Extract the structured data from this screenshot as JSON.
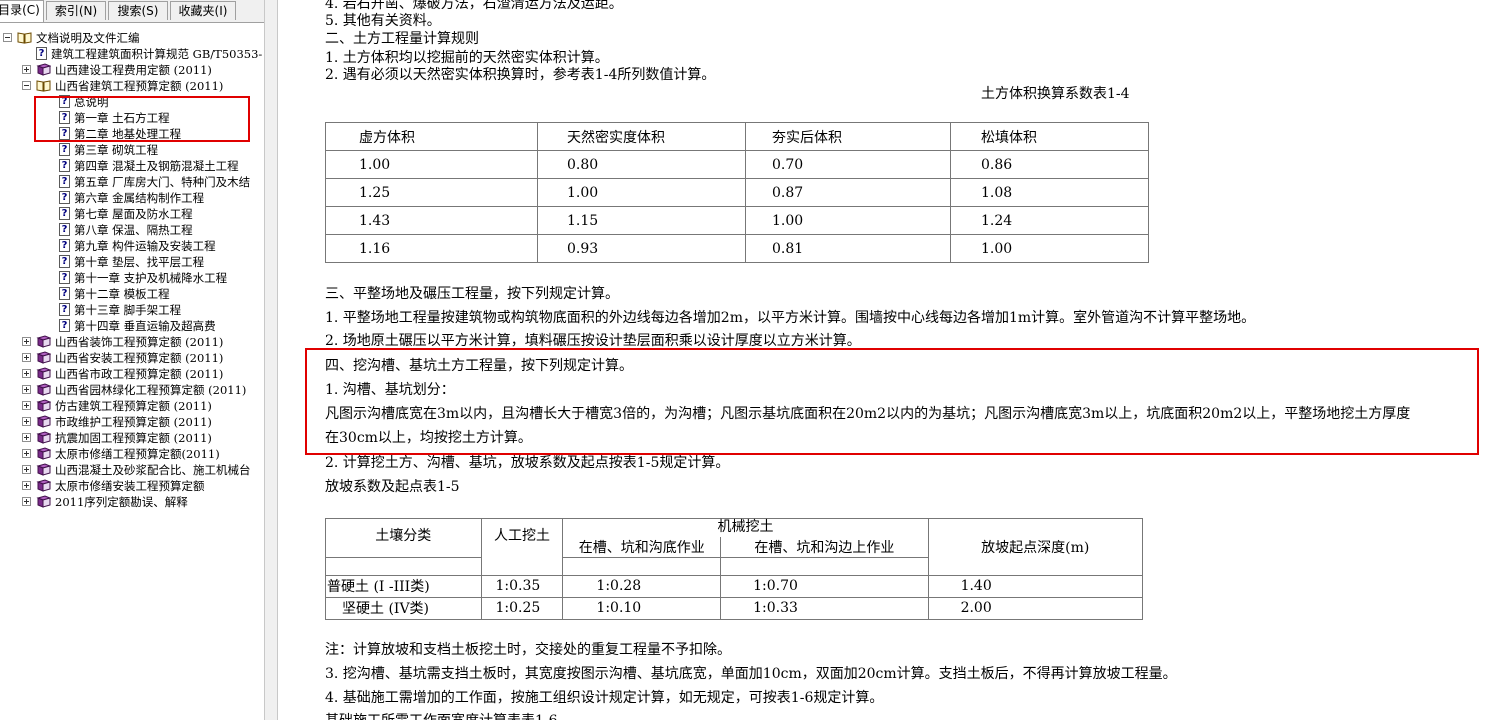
{
  "tabs": [
    {
      "label": "目录(C)",
      "active": true
    },
    {
      "label": "索引(N)",
      "active": false
    },
    {
      "label": "搜索(S)",
      "active": false
    },
    {
      "label": "收藏夹(I)",
      "active": false
    }
  ],
  "tree": [
    {
      "label": "文档说明及文件汇编",
      "level": 0,
      "icon": "open-book-icon",
      "expander": "minus"
    },
    {
      "label": "建筑工程建筑面积计算规范 GB/T50353-",
      "level": 1,
      "icon": "help-page-icon",
      "expander": ""
    },
    {
      "label": "山西建设工程费用定额 (2011)",
      "level": 1,
      "icon": "book-icon",
      "expander": "plus"
    },
    {
      "label": "山西省建筑工程预算定额 (2011)",
      "level": 1,
      "icon": "open-book-icon",
      "expander": "minus"
    },
    {
      "label": "总说明",
      "level": 2,
      "icon": "help-page-icon",
      "expander": ""
    },
    {
      "label": "第一章 土石方工程",
      "level": 2,
      "icon": "help-page-icon",
      "expander": ""
    },
    {
      "label": "第二章 地基处理工程",
      "level": 2,
      "icon": "help-page-icon",
      "expander": ""
    },
    {
      "label": "第三章 砌筑工程",
      "level": 2,
      "icon": "help-page-icon",
      "expander": ""
    },
    {
      "label": "第四章 混凝土及钢筋混凝土工程",
      "level": 2,
      "icon": "help-page-icon",
      "expander": ""
    },
    {
      "label": "第五章 厂库房大门、特种门及木结",
      "level": 2,
      "icon": "help-page-icon",
      "expander": ""
    },
    {
      "label": "第六章 金属结构制作工程",
      "level": 2,
      "icon": "help-page-icon",
      "expander": ""
    },
    {
      "label": "第七章 屋面及防水工程",
      "level": 2,
      "icon": "help-page-icon",
      "expander": ""
    },
    {
      "label": "第八章 保温、隔热工程",
      "level": 2,
      "icon": "help-page-icon",
      "expander": ""
    },
    {
      "label": "第九章 构件运输及安装工程",
      "level": 2,
      "icon": "help-page-icon",
      "expander": ""
    },
    {
      "label": "第十章 垫层、找平层工程",
      "level": 2,
      "icon": "help-page-icon",
      "expander": ""
    },
    {
      "label": "第十一章 支护及机械降水工程",
      "level": 2,
      "icon": "help-page-icon",
      "expander": ""
    },
    {
      "label": "第十二章 模板工程",
      "level": 2,
      "icon": "help-page-icon",
      "expander": ""
    },
    {
      "label": "第十三章 脚手架工程",
      "level": 2,
      "icon": "help-page-icon",
      "expander": ""
    },
    {
      "label": "第十四章 垂直运输及超高费",
      "level": 2,
      "icon": "help-page-icon",
      "expander": ""
    },
    {
      "label": "山西省装饰工程预算定额 (2011)",
      "level": 1,
      "icon": "book-icon",
      "expander": "plus"
    },
    {
      "label": "山西省安装工程预算定额 (2011)",
      "level": 1,
      "icon": "book-icon",
      "expander": "plus"
    },
    {
      "label": "山西省市政工程预算定额 (2011)",
      "level": 1,
      "icon": "book-icon",
      "expander": "plus"
    },
    {
      "label": "山西省园林绿化工程预算定额 (2011)",
      "level": 1,
      "icon": "book-icon",
      "expander": "plus"
    },
    {
      "label": "仿古建筑工程预算定额 (2011)",
      "level": 1,
      "icon": "book-icon",
      "expander": "plus"
    },
    {
      "label": "市政维护工程预算定额 (2011)",
      "level": 1,
      "icon": "book-icon",
      "expander": "plus"
    },
    {
      "label": "抗震加固工程预算定额 (2011)",
      "level": 1,
      "icon": "book-icon",
      "expander": "plus"
    },
    {
      "label": "太原市修缮工程预算定额(2011)",
      "level": 1,
      "icon": "book-icon",
      "expander": "plus"
    },
    {
      "label": "山西混凝土及砂浆配合比、施工机械台",
      "level": 1,
      "icon": "book-icon",
      "expander": "plus"
    },
    {
      "label": "太原市修缮安装工程预算定额",
      "level": 1,
      "icon": "book-icon",
      "expander": "plus"
    },
    {
      "label": "2011序列定额勘误、解释",
      "level": 1,
      "icon": "book-icon",
      "expander": "plus"
    }
  ],
  "content": {
    "lines_top": [
      "4. 岩石开凿、爆破方法，石渣清运方法及运距。",
      "5. 其他有关资料。",
      "二、土方工程量计算规则",
      "1. 土方体积均以挖掘前的天然密实体积计算。",
      "2. 遇有必须以天然密实体积换算时，参考表1-4所列数值计算。"
    ],
    "table1_title": "土方体积换算系数表1-4",
    "table1": {
      "headers": [
        "虚方体积",
        "天然密实度体积",
        "夯实后体积",
        "松填体积"
      ],
      "rows": [
        [
          "1.00",
          "0.80",
          "0.70",
          "0.86"
        ],
        [
          "1.25",
          "1.00",
          "0.87",
          "1.08"
        ],
        [
          "1.43",
          "1.15",
          "1.00",
          "1.24"
        ],
        [
          "1.16",
          "0.93",
          "0.81",
          "1.00"
        ]
      ]
    },
    "lines_mid": [
      "三、平整场地及碾压工程量，按下列规定计算。",
      "1. 平整场地工程量按建筑物或构筑物底面积的外边线每边各增加2m，以平方米计算。围墙按中心线每边各增加1m计算。室外管道沟不计算平整场地。",
      "2. 场地原土碾压以平方米计算，填料碾压按设计垫层面积乘以设计厚度以立方米计算。",
      "四、挖沟槽、基坑土方工程量，按下列规定计算。",
      "1. 沟槽、基坑划分：",
      "凡图示沟槽底宽在3m以内，且沟槽长大于槽宽3倍的，为沟槽；凡图示基坑底面积在20m2以内的为基坑；凡图示沟槽底宽3m以上，坑底面积20m2以上，平整场地挖土方厚度",
      "在30cm以上，均按挖土方计算。",
      "2. 计算挖土方、沟槽、基坑，放坡系数及起点按表1-5规定计算。",
      "放坡系数及起点表1-5"
    ],
    "table2": {
      "col_soil": "土壤分类",
      "col_manual": "人工挖土",
      "col_machine": "机械挖土",
      "col_machine_in": "在槽、坑和沟底作业",
      "col_machine_edge": "在槽、坑和沟边上作业",
      "col_depth": "放坡起点深度(m)",
      "rows": [
        [
          "普硬土 (I -III类)",
          "1:0.35",
          "1:0.28",
          "1:0.70",
          "1.40"
        ],
        [
          "坚硬土 (IV类)",
          "1:0.25",
          "1:0.10",
          "1:0.33",
          "2.00"
        ]
      ]
    },
    "lines_bottom": [
      "注：计算放坡和支档土板挖土时，交接处的重复工程量不予扣除。",
      "3. 挖沟槽、基坑需支挡土板时，其宽度按图示沟槽、基坑底宽，单面加10cm，双面加20cm计算。支挡土板后，不得再计算放坡工程量。",
      "4. 基础施工需增加的工作面，按施工组织设计规定计算，如无规定，可按表1-6规定计算。",
      "基础施工所需工作面宽度计算表表1-6"
    ]
  },
  "highlight_color": "#e00000"
}
